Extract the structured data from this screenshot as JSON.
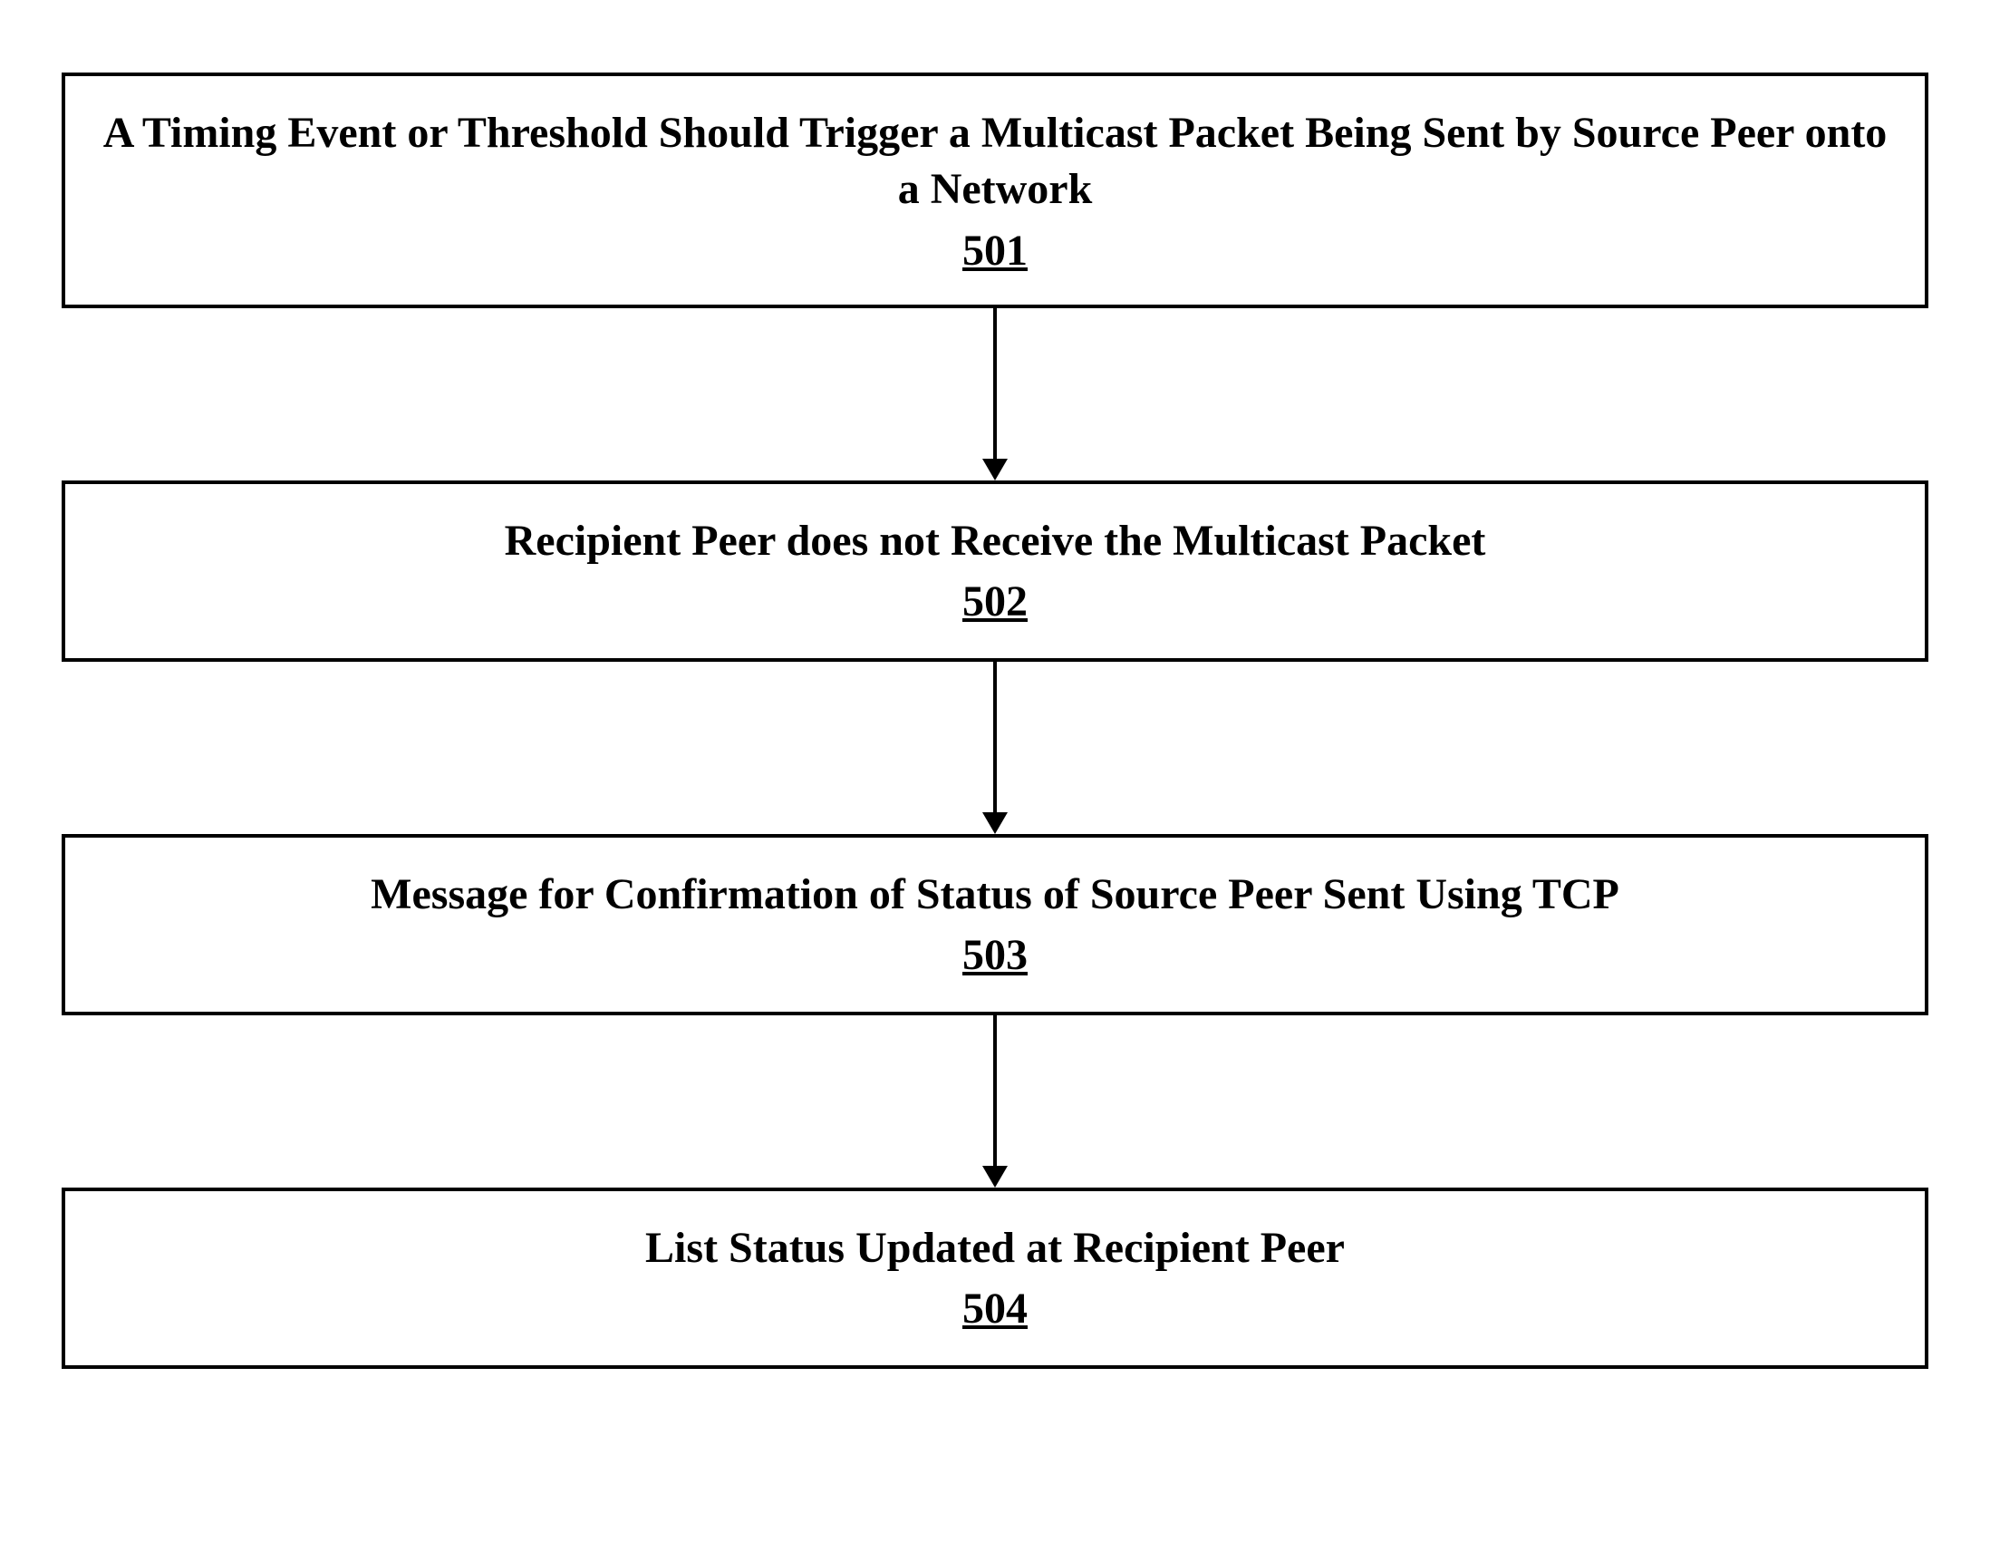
{
  "flowchart": {
    "steps": [
      {
        "text": "A Timing Event or Threshold Should Trigger a Multicast Packet Being Sent by Source Peer onto a Network",
        "number": "501"
      },
      {
        "text": "Recipient Peer does not Receive the Multicast Packet",
        "number": "502"
      },
      {
        "text": "Message for Confirmation of Status of Source Peer Sent Using TCP",
        "number": "503"
      },
      {
        "text": "List Status Updated at Recipient Peer",
        "number": "504"
      }
    ]
  }
}
